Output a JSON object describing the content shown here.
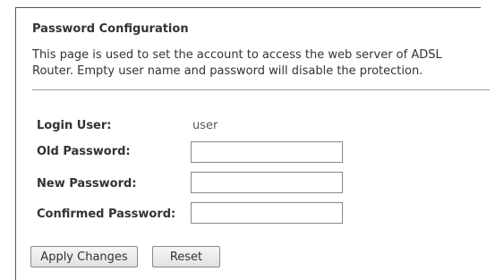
{
  "page": {
    "title": "Password Configuration",
    "description": "This page is used to set the account to access the web server of ADSL Router. Empty user name and password will disable the protection."
  },
  "form": {
    "login_user": {
      "label": "Login User:",
      "value": "user"
    },
    "old_password": {
      "label": "Old Password:",
      "value": ""
    },
    "new_password": {
      "label": "New Password:",
      "value": ""
    },
    "confirmed_password": {
      "label": "Confirmed Password:",
      "value": ""
    }
  },
  "buttons": {
    "apply": "Apply Changes",
    "reset": "Reset"
  }
}
